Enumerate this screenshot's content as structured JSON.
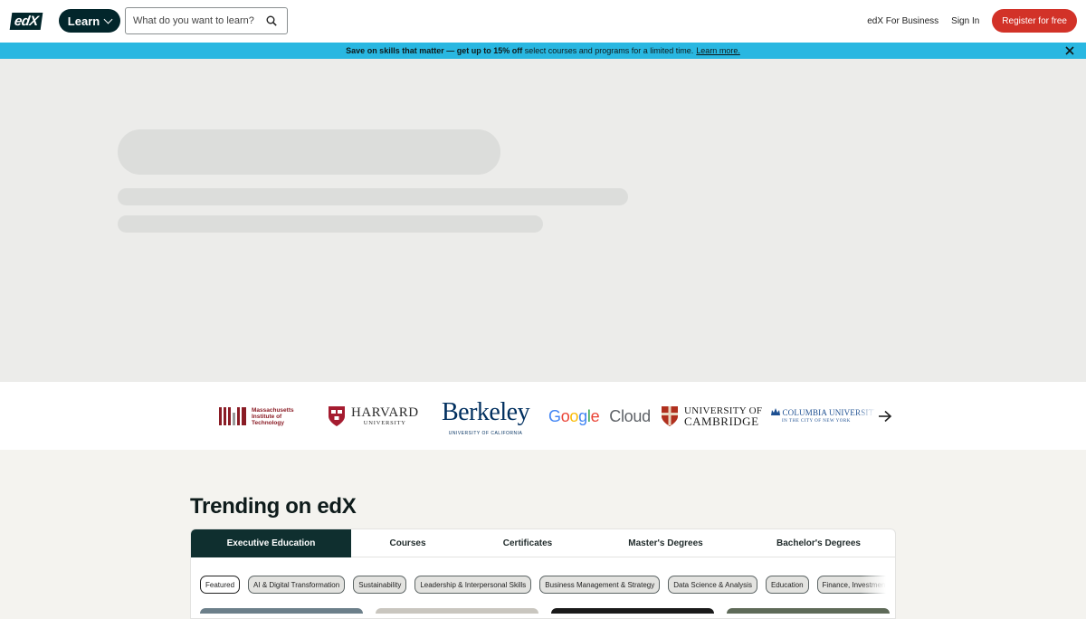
{
  "header": {
    "logo_text": "edX",
    "learn_label": "Learn",
    "search_placeholder": "What do you want to learn?",
    "business_label": "edX For Business",
    "signin_label": "Sign In",
    "register_label": "Register for free"
  },
  "promo": {
    "bold_text": "Save on skills that matter — get up to 15% off",
    "rest_text": " select courses and programs for a limited time.",
    "link_text": "Learn more."
  },
  "partners": {
    "mit_lines": [
      "Massachusetts",
      "Institute of",
      "Technology"
    ],
    "harvard_big": "HARVARD",
    "harvard_small": "UNIVERSITY",
    "berkeley_big": "Berkeley",
    "berkeley_small": "UNIVERSITY OF CALIFORNIA",
    "google_letters": [
      "G",
      "o",
      "o",
      "g",
      "l",
      "e"
    ],
    "google_cloud": "Cloud",
    "cambridge_l1": "UNIVERSITY OF",
    "cambridge_l2": "CAMBRIDGE",
    "columbia_l1": "COLUMBIA UNIVERSITY",
    "columbia_l2": "IN THE CITY OF NEW YORK"
  },
  "trending": {
    "title": "Trending on edX",
    "tabs": [
      "Executive Education",
      "Courses",
      "Certificates",
      "Master's Degrees",
      "Bachelor's Degrees"
    ],
    "active_tab": "Executive Education",
    "chips": [
      "Featured",
      "AI & Digital Transformation",
      "Sustainability",
      "Leadership & Interpersonal Skills",
      "Business Management & Strategy",
      "Data Science & Analysis",
      "Education",
      "Finance, Investment & Economics"
    ],
    "active_chip": "Featured"
  },
  "colors": {
    "brand_dark": "#02262b",
    "register_red": "#d23228",
    "promo_blue": "#29b7e1"
  }
}
